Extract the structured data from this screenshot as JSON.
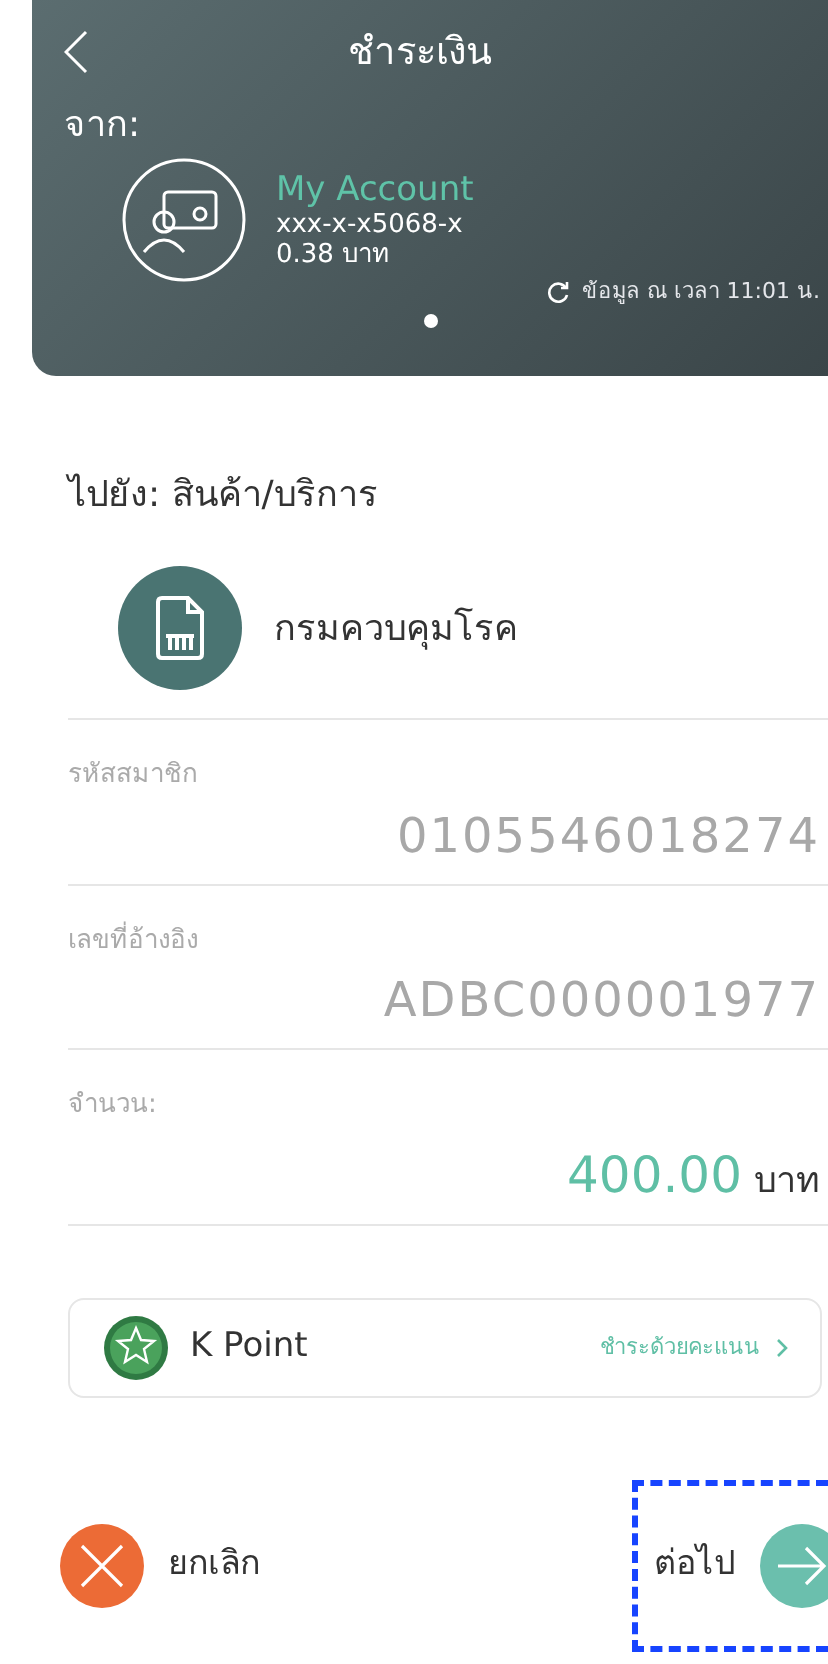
{
  "header": {
    "title": "ชำระเงิน",
    "from_label": "จาก:",
    "account": {
      "name": "My Account",
      "number": "xxx-x-x5068-x",
      "balance": "0.38 บาท"
    },
    "updated": "ข้อมูล ณ เวลา 11:01 น.",
    "pager": [
      {
        "selected": true
      }
    ]
  },
  "to_label": "ไปยัง: สินค้า/บริการ",
  "payee": "กรมควบคุมโรค",
  "fields": [
    {
      "label": "รหัสสมาชิก",
      "value": "0105546018274",
      "kind": "plain"
    },
    {
      "label": "เลขที่อ้างอิง",
      "value": "ADBC000001977",
      "kind": "plain"
    },
    {
      "label": "จำนวน:",
      "value": "400.00",
      "unit": "บาท",
      "kind": "amount"
    }
  ],
  "kpoint": {
    "label": "K Point",
    "action": "ชำระด้วยคะแนน"
  },
  "buttons": [
    {
      "kind": "cancel",
      "label": "ยกเลิก",
      "highlighted": false
    },
    {
      "kind": "next",
      "label": "ต่อไป",
      "highlighted": true
    }
  ]
}
